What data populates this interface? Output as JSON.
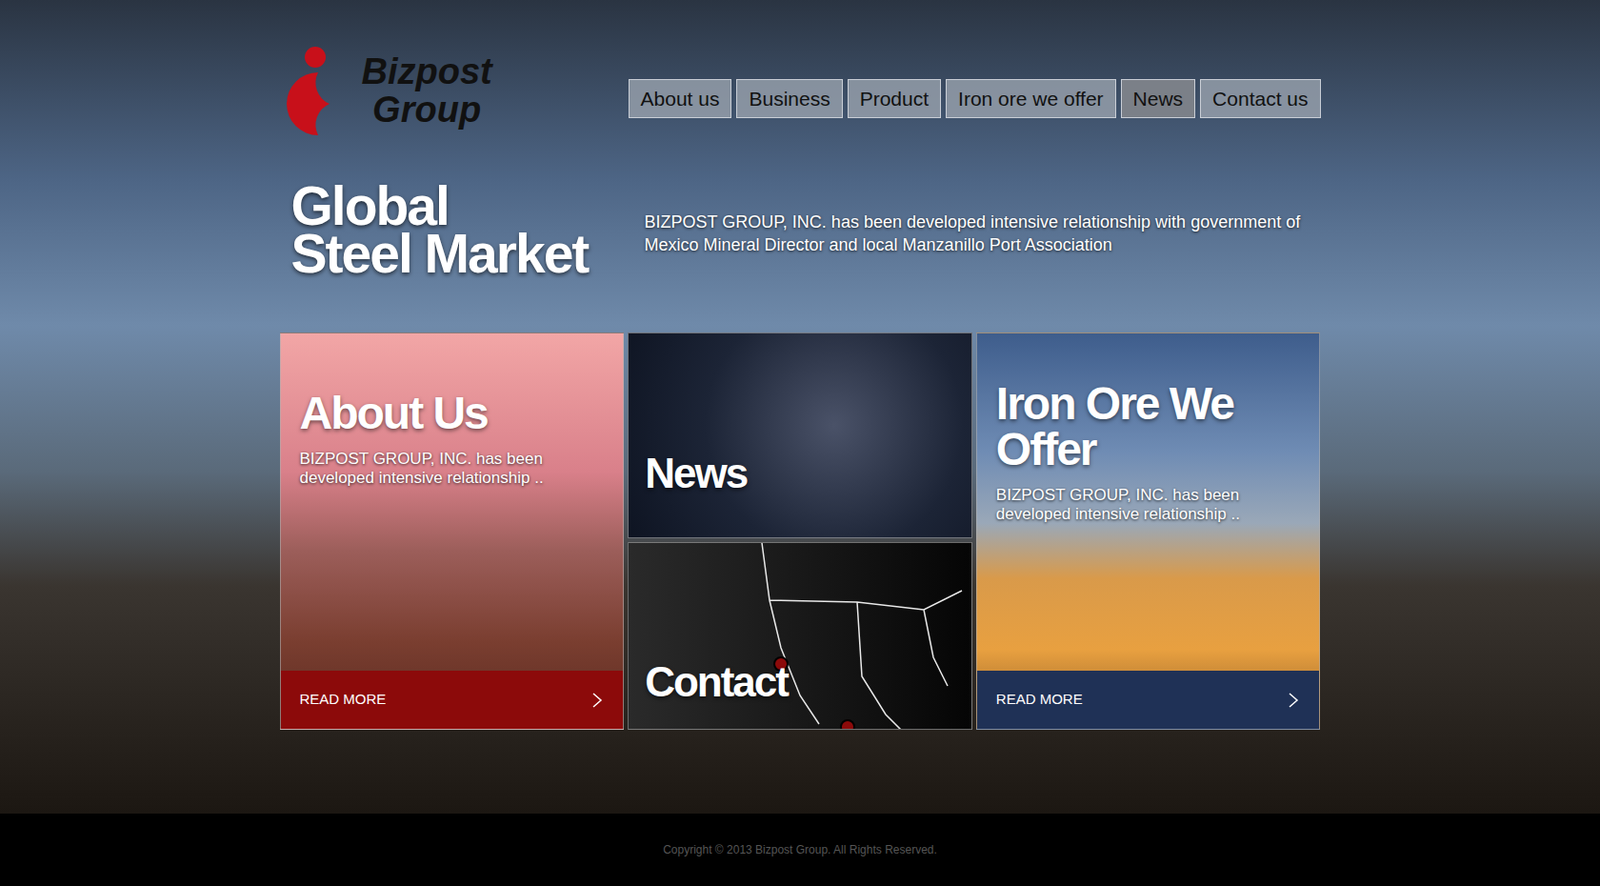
{
  "logo": {
    "line1": "Bizpost",
    "line2": "Group"
  },
  "nav": [
    {
      "label": "About us",
      "selected": false
    },
    {
      "label": "Business",
      "selected": false
    },
    {
      "label": "Product",
      "selected": false
    },
    {
      "label": "Iron ore we offer",
      "selected": false
    },
    {
      "label": "News",
      "selected": true
    },
    {
      "label": "Contact us",
      "selected": false
    }
  ],
  "hero": {
    "title_lines": [
      "Global",
      "Steel Market"
    ],
    "description": "BIZPOST GROUP, INC. has been developed intensive relationship with government of Mexico Mineral Director and local Manzanillo Port Association"
  },
  "cards": {
    "about": {
      "title": "About Us",
      "text": "BIZPOST GROUP, INC. has been developed intensive relationship ..",
      "button": "READ MORE"
    },
    "news": {
      "title": "News"
    },
    "contact": {
      "title": "Contact"
    },
    "iron_ore": {
      "title": "Iron Ore We Offer",
      "text": "BIZPOST GROUP, INC. has been developed intensive relationship ..",
      "button": "READ MORE"
    }
  },
  "footer": {
    "copyright": "Copyright © 2013 Bizpost Group. All Rights Reserved."
  }
}
